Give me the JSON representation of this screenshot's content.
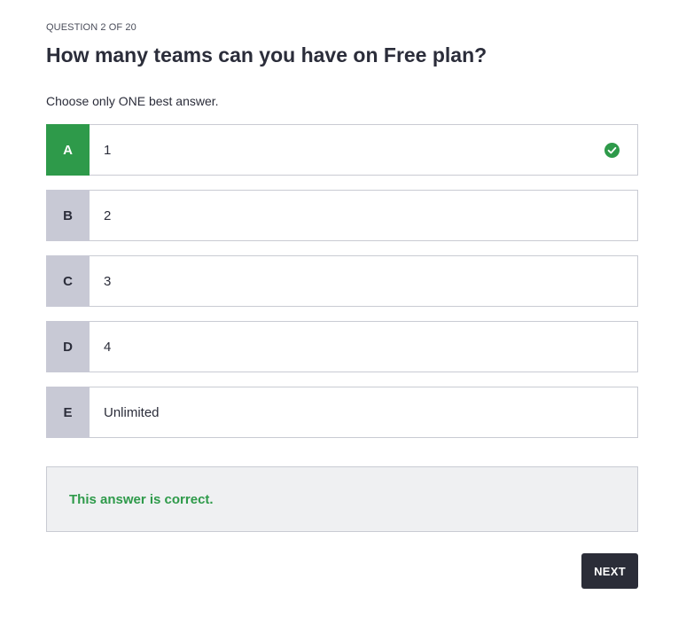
{
  "quiz": {
    "progress": "QUESTION 2 OF 20",
    "question": "How many teams can you have on Free plan?",
    "instruction": "Choose only ONE best answer.",
    "options": [
      {
        "letter": "A",
        "text": "1",
        "state": "correct"
      },
      {
        "letter": "B",
        "text": "2",
        "state": "default"
      },
      {
        "letter": "C",
        "text": "3",
        "state": "default"
      },
      {
        "letter": "D",
        "text": "4",
        "state": "default"
      },
      {
        "letter": "E",
        "text": "Unlimited",
        "state": "default"
      }
    ],
    "feedback": "This answer is correct.",
    "next_label": "NEXT"
  },
  "icons": {
    "correct": "check-circle-icon"
  },
  "colors": {
    "correct_green": "#2e9a4a",
    "letter_default_bg": "#c8c9d5",
    "feedback_bg": "#eff0f2",
    "button_bg": "#2b2d38",
    "text": "#2b2d3a"
  }
}
